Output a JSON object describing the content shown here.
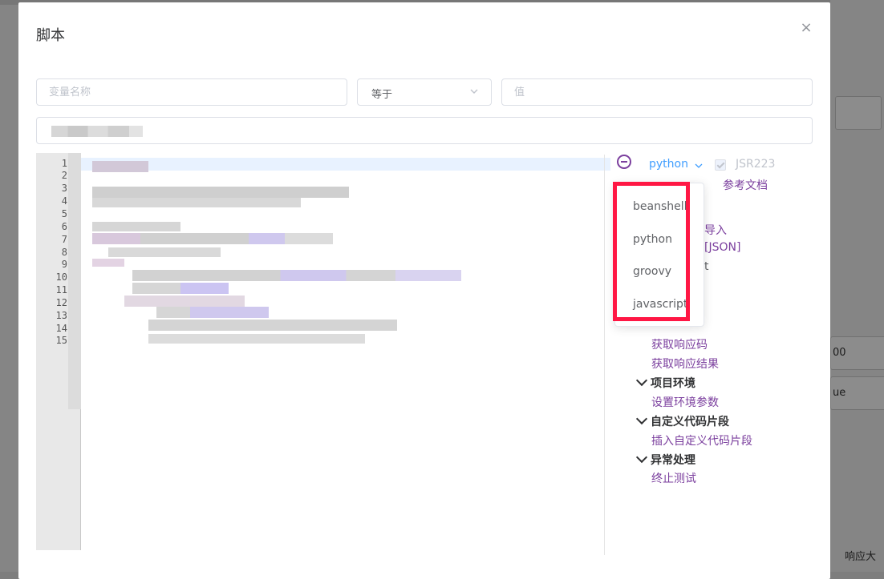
{
  "background": {
    "right_values": [
      "00",
      "ue"
    ],
    "bottom_right_label": "响应大"
  },
  "dialog": {
    "title": "脚本",
    "close_symbol": "×",
    "filters": {
      "variable_placeholder": "变量名称",
      "operator_value": "等于",
      "value_placeholder": "值"
    },
    "line_numbers": [
      "1",
      "2",
      "3",
      "4",
      "5",
      "6",
      "7",
      "8",
      "9",
      "10",
      "11",
      "12",
      "13",
      "14",
      "15"
    ]
  },
  "script_panel": {
    "language": "python",
    "jsr223_label": "JSR223",
    "ref_doc_link": "参考文档",
    "partial_links": [
      "导入",
      "[JSON]",
      "t"
    ],
    "links_after_dropdown": [
      "获取响应码",
      "获取响应结果"
    ],
    "sections": [
      {
        "title": "项目环境",
        "items": [
          "设置环境参数"
        ]
      },
      {
        "title": "自定义代码片段",
        "items": [
          "插入自定义代码片段"
        ]
      },
      {
        "title": "异常处理",
        "items": [
          "终止测试"
        ]
      }
    ]
  },
  "language_dropdown": {
    "options": [
      "beanshell",
      "python",
      "groovy",
      "javascript"
    ]
  },
  "colors": {
    "accent_purple": "#7b3f9e",
    "link_blue": "#409eff",
    "highlight_red": "#ff1744"
  }
}
